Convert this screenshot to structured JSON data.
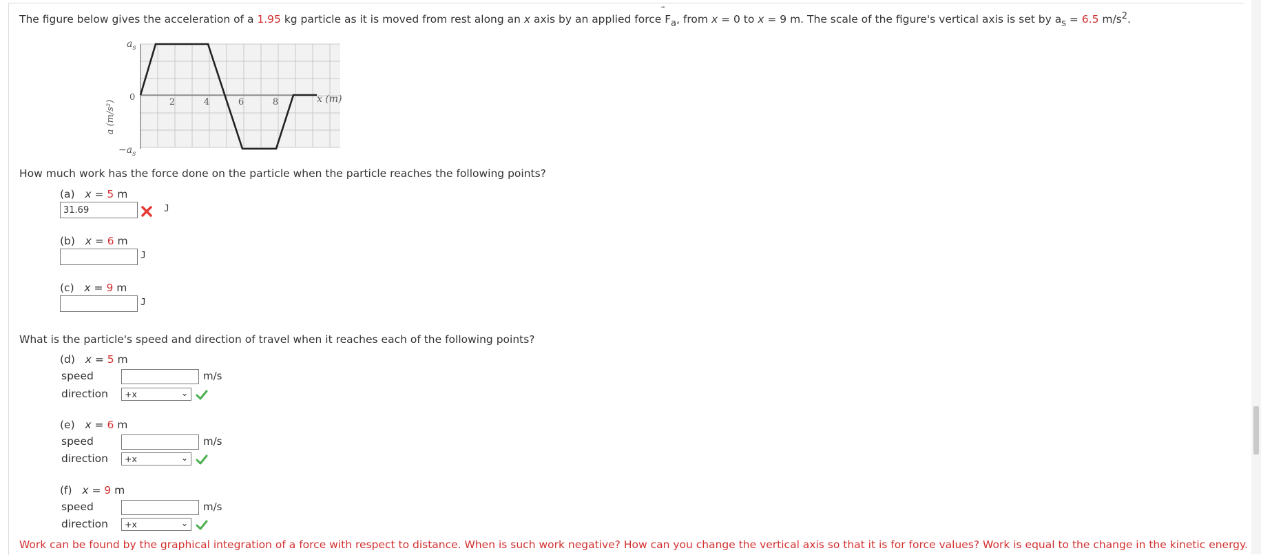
{
  "intro": {
    "p1": "The figure below gives the acceleration of a ",
    "mass": "1.95",
    "p2": " kg particle as it is moved from rest along an ",
    "x_var": "x",
    "p3": " axis by an applied force ",
    "force": "F",
    "force_sub": "a",
    "p4": ", from ",
    "from_x": "x",
    "p5": " = 0 to ",
    "to_x": "x",
    "p6": " = 9 m. The scale of the figure's vertical axis is set by a",
    "as_sub": "s",
    "p7": " = ",
    "as_value": "6.5",
    "p8": " m/s",
    "p8_sup": "2",
    "p9": "."
  },
  "figure": {
    "ytop_label": "a",
    "ytop_sub": "s",
    "ybottom_label": "−a",
    "ybottom_sub": "s",
    "zero_label": "0",
    "ylabel": "a (m/s²)",
    "xlabel": "x (m)",
    "xticks": [
      "2",
      "4",
      "6",
      "8"
    ]
  },
  "work": {
    "question": "How much work has the force done on the particle when the particle reaches the following points?",
    "parts": [
      {
        "tag": "(a)",
        "xv": "x",
        "eq": " = ",
        "val": "5",
        "unit_m": " m",
        "answer": "31.69",
        "unit": "J",
        "status": "wrong"
      },
      {
        "tag": "(b)",
        "xv": "x",
        "eq": " = ",
        "val": "6",
        "unit_m": " m",
        "answer": "",
        "unit": "J",
        "status": "none"
      },
      {
        "tag": "(c)",
        "xv": "x",
        "eq": " = ",
        "val": "9",
        "unit_m": " m",
        "answer": "",
        "unit": "J",
        "status": "none"
      }
    ]
  },
  "speed": {
    "question": "What is the particle's speed and direction of travel when it reaches each of the following points?",
    "speed_label": "speed",
    "direction_label": "direction",
    "unit": "m/s",
    "parts": [
      {
        "tag": "(d)",
        "xv": "x",
        "eq": " = ",
        "val": "5",
        "unit_m": " m",
        "speed": "",
        "direction": "+x"
      },
      {
        "tag": "(e)",
        "xv": "x",
        "eq": " = ",
        "val": "6",
        "unit_m": " m",
        "speed": "",
        "direction": "+x"
      },
      {
        "tag": "(f)",
        "xv": "x",
        "eq": " = ",
        "val": "9",
        "unit_m": " m",
        "speed": "",
        "direction": "+x"
      }
    ]
  },
  "hint": "Work can be found by the graphical integration of a force with respect to distance. When is such work negative? How can you change the vertical axis so that it is for force values? Work is equal to the change in the kinetic energy. How is",
  "colors": {
    "accent_red": "#d32f2f",
    "check_green": "#4caf50",
    "wrong_red": "#e53935"
  }
}
